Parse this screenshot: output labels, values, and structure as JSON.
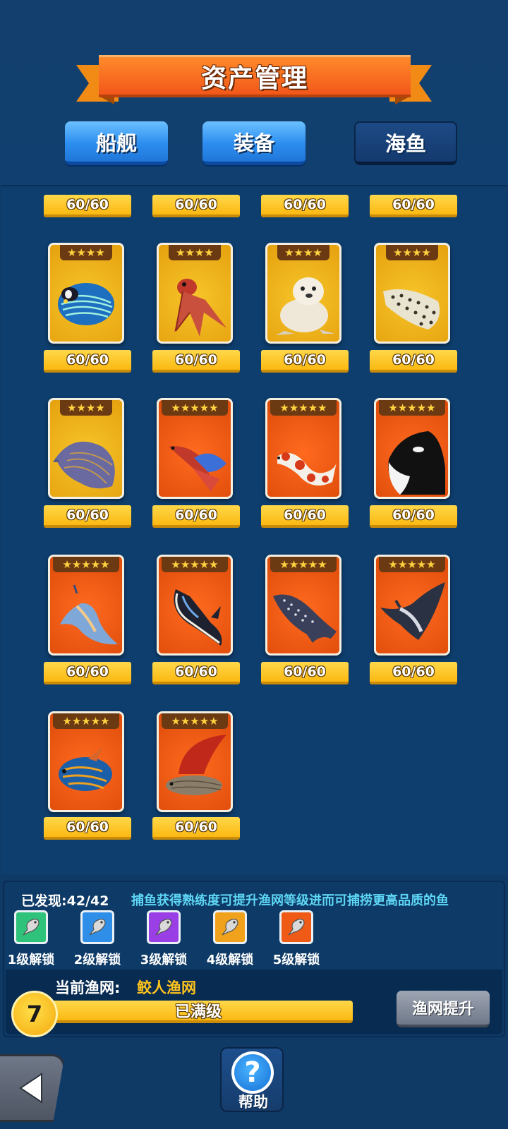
{
  "title": "资产管理",
  "tabs": [
    {
      "label": "船舰",
      "state": "active"
    },
    {
      "label": "装备",
      "state": "active"
    },
    {
      "label": "海鱼",
      "state": "selected"
    }
  ],
  "top_row_progress": [
    "60/60",
    "60/60",
    "60/60",
    "60/60"
  ],
  "fish": [
    {
      "name": "angelfish-icon",
      "stars": "★★★★",
      "rarity": "yellow",
      "progress": "60/60"
    },
    {
      "name": "batfish-icon",
      "stars": "★★★★",
      "rarity": "yellow",
      "progress": "60/60"
    },
    {
      "name": "seal-icon",
      "stars": "★★★★",
      "rarity": "yellow",
      "progress": "60/60"
    },
    {
      "name": "grouper-icon",
      "stars": "★★★★",
      "rarity": "yellow",
      "progress": "60/60"
    },
    {
      "name": "ray-icon",
      "stars": "★★★★",
      "rarity": "yellow",
      "progress": "60/60"
    },
    {
      "name": "betta-icon",
      "stars": "★★★★★",
      "rarity": "orange",
      "progress": "60/60"
    },
    {
      "name": "koi-icon",
      "stars": "★★★★★",
      "rarity": "orange",
      "progress": "60/60"
    },
    {
      "name": "orca-icon",
      "stars": "★★★★★",
      "rarity": "orange",
      "progress": "60/60"
    },
    {
      "name": "sea-slug-icon",
      "stars": "★★★★★",
      "rarity": "orange",
      "progress": "60/60"
    },
    {
      "name": "nudibranch-icon",
      "stars": "★★★★★",
      "rarity": "orange",
      "progress": "60/60"
    },
    {
      "name": "whale-shark-icon",
      "stars": "★★★★★",
      "rarity": "orange",
      "progress": "60/60"
    },
    {
      "name": "manta-ray-icon",
      "stars": "★★★★★",
      "rarity": "orange",
      "progress": "60/60"
    },
    {
      "name": "mandarinfish-icon",
      "stars": "★★★★★",
      "rarity": "orange",
      "progress": "60/60"
    },
    {
      "name": "fighting-fish-icon",
      "stars": "★★★★★",
      "rarity": "orange",
      "progress": "60/60"
    }
  ],
  "discovered": "已发现:42/42",
  "hint": "捕鱼获得熟练度可提升渔网等级进而可捕捞更高品质的鱼",
  "unlock_levels": [
    {
      "label": "1级解锁",
      "color": "#2ec27a"
    },
    {
      "label": "2级解锁",
      "color": "#2f8fe8"
    },
    {
      "label": "3级解锁",
      "color": "#9a3ee6"
    },
    {
      "label": "4级解锁",
      "color": "#f0a21c"
    },
    {
      "label": "5级解锁",
      "color": "#ef5a16"
    }
  ],
  "net": {
    "label": "当前渔网:",
    "name": "鲛人渔网",
    "level": "7",
    "status": "已满级",
    "upgrade_label": "渔网提升"
  },
  "help_label": "帮助",
  "colors": {
    "background": "#0f3a66",
    "accent_orange": "#f2571a",
    "progress_yellow": "#fbb912",
    "hint_cyan": "#5fd6f5"
  }
}
